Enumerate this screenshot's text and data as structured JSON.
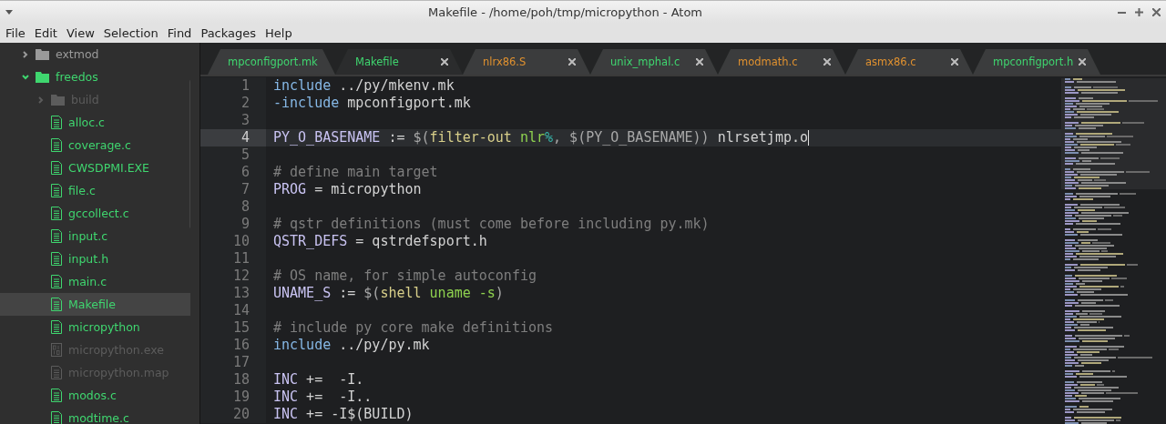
{
  "window": {
    "title": "Makefile - /home/poh/tmp/micropython - Atom"
  },
  "menu": [
    "File",
    "Edit",
    "View",
    "Selection",
    "Find",
    "Packages",
    "Help"
  ],
  "tree": [
    {
      "kind": "folder",
      "name": "extmod",
      "color": "#9a9a9a",
      "expanded": false,
      "selected": false
    },
    {
      "kind": "folder",
      "name": "freedos",
      "color": "#3fd66f",
      "expanded": true,
      "selected": false,
      "children": [
        {
          "kind": "folder",
          "name": "build",
          "color": "#5c5c5c",
          "expanded": false,
          "selected": false
        },
        {
          "kind": "file",
          "name": "alloc.c",
          "color": "#3fd66f",
          "selected": false
        },
        {
          "kind": "file",
          "name": "coverage.c",
          "color": "#3fd66f",
          "selected": false
        },
        {
          "kind": "file",
          "name": "CWSDPMI.EXE",
          "color": "#3fd66f",
          "selected": false
        },
        {
          "kind": "file",
          "name": "file.c",
          "color": "#3fd66f",
          "selected": false
        },
        {
          "kind": "file",
          "name": "gccollect.c",
          "color": "#3fd66f",
          "selected": false
        },
        {
          "kind": "file",
          "name": "input.c",
          "color": "#3fd66f",
          "selected": false
        },
        {
          "kind": "file",
          "name": "input.h",
          "color": "#3fd66f",
          "selected": false
        },
        {
          "kind": "file",
          "name": "main.c",
          "color": "#3fd66f",
          "selected": false
        },
        {
          "kind": "file",
          "name": "Makefile",
          "color": "#3fd66f",
          "selected": true
        },
        {
          "kind": "file",
          "name": "micropython",
          "color": "#3fd66f",
          "selected": false
        },
        {
          "kind": "binary",
          "name": "micropython.exe",
          "color": "#5c5c5c",
          "selected": false
        },
        {
          "kind": "file",
          "name": "micropython.map",
          "color": "#5c5c5c",
          "selected": false
        },
        {
          "kind": "file",
          "name": "modos.c",
          "color": "#3fd66f",
          "selected": false
        },
        {
          "kind": "file",
          "name": "modtime.c",
          "color": "#3fd66f",
          "selected": false
        }
      ]
    }
  ],
  "tabs": [
    {
      "label": "mpconfigport.mk",
      "color": "#3fd66f",
      "selected": false
    },
    {
      "label": "Makefile",
      "color": "#3fd66f",
      "selected": true
    },
    {
      "label": "nlrx86.S",
      "color": "#e0912f",
      "selected": false
    },
    {
      "label": "unix_mphal.c",
      "color": "#3fd66f",
      "selected": false
    },
    {
      "label": "modmath.c",
      "color": "#e0912f",
      "selected": false
    },
    {
      "label": "asmx86.c",
      "color": "#e0912f",
      "selected": false
    },
    {
      "label": "mpconfigport.h",
      "color": "#3fd66f",
      "selected": false
    }
  ],
  "lines": [
    {
      "number": "1",
      "selected": false,
      "tokens": [
        {
          "kind": "keyword",
          "text": "include"
        },
        {
          "kind": "plain",
          "text": " ../py/mkenv.mk"
        }
      ]
    },
    {
      "number": "2",
      "selected": false,
      "tokens": [
        {
          "kind": "keyword",
          "text": "-include"
        },
        {
          "kind": "plain",
          "text": " mpconfigport.mk"
        }
      ]
    },
    {
      "number": "3",
      "selected": false
    },
    {
      "number": "4",
      "selected": true,
      "tokens": [
        {
          "kind": "variable",
          "text": "PY_O_BASENAME"
        },
        {
          "kind": "plain",
          "text": " := "
        },
        {
          "kind": "paren",
          "text": "$("
        },
        {
          "kind": "function",
          "text": "filter-out"
        },
        {
          "kind": "string",
          "text": " nlr"
        },
        {
          "kind": "special",
          "text": "%"
        },
        {
          "kind": "paren",
          "text": ", $(PY_O_BASENAME))"
        },
        {
          "kind": "plain",
          "text": " nlrsetjmp.o"
        }
      ]
    },
    {
      "number": "5",
      "selected": false
    },
    {
      "number": "6",
      "selected": false,
      "tokens": [
        {
          "kind": "comment",
          "text": "# define main target"
        }
      ]
    },
    {
      "number": "7",
      "selected": false,
      "tokens": [
        {
          "kind": "variable",
          "text": "PROG"
        },
        {
          "kind": "plain",
          "text": " = micropython"
        }
      ]
    },
    {
      "number": "8",
      "selected": false
    },
    {
      "number": "9",
      "selected": false,
      "tokens": [
        {
          "kind": "comment",
          "text": "# qstr definitions (must come before including py.mk)"
        }
      ]
    },
    {
      "number": "10",
      "selected": false,
      "tokens": [
        {
          "kind": "variable",
          "text": "QSTR_DEFS"
        },
        {
          "kind": "plain",
          "text": " = qstrdefsport.h"
        }
      ]
    },
    {
      "number": "11",
      "selected": false
    },
    {
      "number": "12",
      "selected": false,
      "tokens": [
        {
          "kind": "comment",
          "text": "# OS name, for simple autoconfig"
        }
      ]
    },
    {
      "number": "13",
      "selected": false,
      "tokens": [
        {
          "kind": "variable",
          "text": "UNAME_S"
        },
        {
          "kind": "plain",
          "text": " := "
        },
        {
          "kind": "paren",
          "text": "$("
        },
        {
          "kind": "function",
          "text": "shell"
        },
        {
          "kind": "string",
          "text": " uname -s"
        },
        {
          "kind": "paren",
          "text": ")"
        }
      ]
    },
    {
      "number": "14",
      "selected": false
    },
    {
      "number": "15",
      "selected": false,
      "tokens": [
        {
          "kind": "comment",
          "text": "# include py core make definitions"
        }
      ]
    },
    {
      "number": "16",
      "selected": false,
      "tokens": [
        {
          "kind": "keyword",
          "text": "include"
        },
        {
          "kind": "plain",
          "text": " ../py/py.mk"
        }
      ]
    },
    {
      "number": "17",
      "selected": false
    },
    {
      "number": "18",
      "selected": false,
      "tokens": [
        {
          "kind": "variable",
          "text": "INC"
        },
        {
          "kind": "plain",
          "text": " +=  -I."
        }
      ]
    },
    {
      "number": "19",
      "selected": false,
      "tokens": [
        {
          "kind": "variable",
          "text": "INC"
        },
        {
          "kind": "plain",
          "text": " +=  -I.."
        }
      ]
    },
    {
      "number": "20",
      "selected": false,
      "tokens": [
        {
          "kind": "variable",
          "text": "INC"
        },
        {
          "kind": "plain",
          "text": " += -I$(BUILD)"
        }
      ]
    }
  ]
}
